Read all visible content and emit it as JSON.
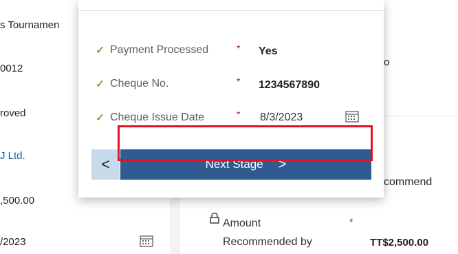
{
  "left_panel": {
    "row1": "s Tournamen",
    "row2": "0012",
    "row3": "roved",
    "row4": "J Ltd.",
    "row5": ",500.00",
    "row6": "/2023"
  },
  "right_panel": {
    "top_text": "o",
    "recommend_text": "commend",
    "amount_label": "Amount",
    "recommended_by_label": "Recommended by",
    "amount_value": "TT$2,500.00",
    "required_mark": "*"
  },
  "flyout": {
    "fields": [
      {
        "check": "✓",
        "label": "Payment Processed",
        "required": "*",
        "value": "Yes"
      },
      {
        "check": "✓",
        "label": "Cheque No.",
        "required": "*",
        "value": "1234567890"
      },
      {
        "check": "✓",
        "label": "Cheque Issue Date",
        "required": "*",
        "value": "8/3/2023"
      }
    ],
    "back_glyph": "<",
    "next_label": "Next Stage",
    "next_glyph": ">"
  },
  "icons": {
    "calendar": "calendar-icon",
    "lock": "lock-icon"
  },
  "colors": {
    "button_primary": "#2f5b91",
    "button_back": "#c7d9ea",
    "highlight": "#e81123",
    "check": "#498205",
    "required": "#a4262c",
    "link": "#115ea3"
  }
}
